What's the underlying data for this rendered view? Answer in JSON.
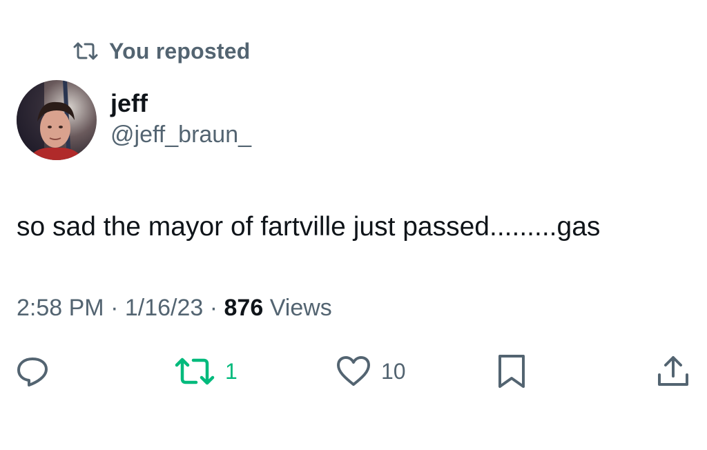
{
  "repost_header": {
    "label": "You reposted",
    "icon": "repost-icon"
  },
  "author": {
    "display_name": "jeff",
    "handle": "@jeff_braun_",
    "avatar_icon": "avatar-photo"
  },
  "tweet": {
    "text": "so sad the mayor of fartville just passed.........gas"
  },
  "meta": {
    "time": "2:58 PM",
    "date": "1/16/23",
    "separator": " · ",
    "views_count": "876",
    "views_label": " Views"
  },
  "actions": {
    "reply": {
      "icon": "reply-icon",
      "count": ""
    },
    "repost": {
      "icon": "repost-icon",
      "count": "1",
      "color": "#00ba7c"
    },
    "like": {
      "icon": "heart-icon",
      "count": "10"
    },
    "bookmark": {
      "icon": "bookmark-icon"
    },
    "share": {
      "icon": "share-icon"
    }
  },
  "colors": {
    "primary_text": "#0f1419",
    "secondary_text": "#536471",
    "repost_green": "#00ba7c"
  }
}
